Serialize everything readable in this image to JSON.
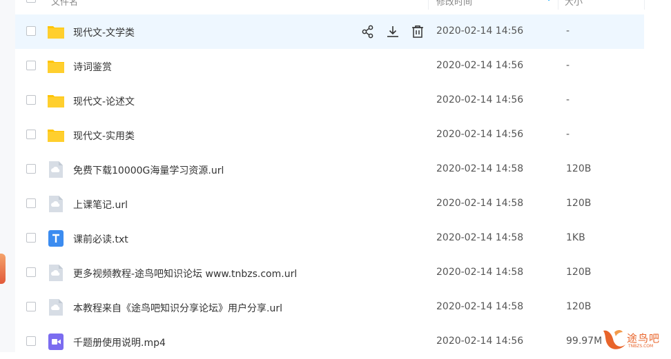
{
  "header": {
    "col_name": "文件名",
    "col_time": "修改时间",
    "col_size": "大小"
  },
  "files": [
    {
      "name": "现代文-文学类",
      "time": "2020-02-14 14:56",
      "size": "-",
      "type": "folder"
    },
    {
      "name": "诗词鉴赏",
      "time": "2020-02-14 14:56",
      "size": "-",
      "type": "folder"
    },
    {
      "name": "现代文-论述文",
      "time": "2020-02-14 14:56",
      "size": "-",
      "type": "folder"
    },
    {
      "name": "现代文-实用类",
      "time": "2020-02-14 14:56",
      "size": "-",
      "type": "folder"
    },
    {
      "name": "免费下载10000G海量学习资源.url",
      "time": "2020-02-14 14:58",
      "size": "120B",
      "type": "url"
    },
    {
      "name": "上课笔记.url",
      "time": "2020-02-14 14:58",
      "size": "120B",
      "type": "url"
    },
    {
      "name": "课前必读.txt",
      "time": "2020-02-14 14:58",
      "size": "1KB",
      "type": "txt"
    },
    {
      "name": "更多视频教程-途鸟吧知识论坛 www.tnbzs.com.url",
      "time": "2020-02-14 14:58",
      "size": "120B",
      "type": "url"
    },
    {
      "name": "本教程来自《途鸟吧知识分享论坛》用户分享.url",
      "time": "2020-02-14 14:58",
      "size": "120B",
      "type": "url"
    },
    {
      "name": "千题册使用说明.mp4",
      "time": "2020-02-14 14:56",
      "size": "99.97M",
      "type": "video"
    }
  ],
  "row_actions": [
    "share-icon",
    "download-icon",
    "delete-icon"
  ],
  "watermark": {
    "text": "途鸟吧",
    "sub": "TNBZS.COM"
  },
  "colors": {
    "accent": "#06a7ff",
    "folder": "#ffc402",
    "hover_row": "#eef7ff"
  }
}
